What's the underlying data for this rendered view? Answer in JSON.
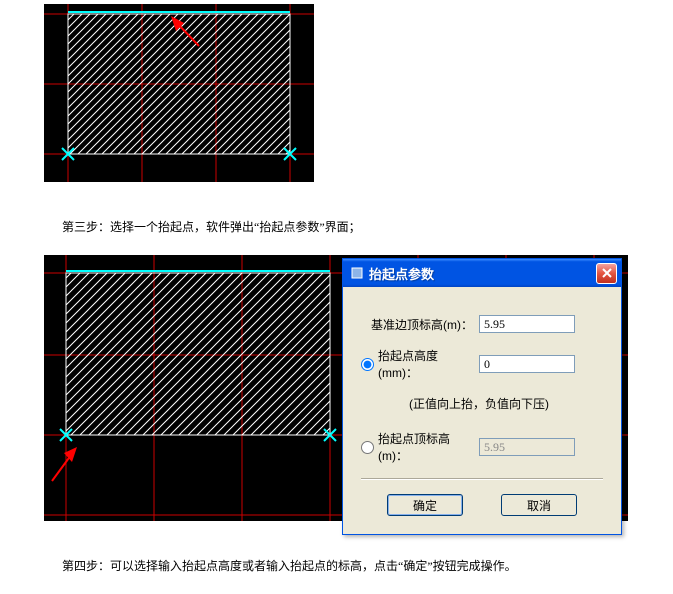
{
  "step3": "第三步：选择一个抬起点，软件弹出“抬起点参数”界面；",
  "step4": "第四步：可以选择输入抬起点高度或者输入抬起点的标高，点击“确定”按钮完成操作。",
  "dialog": {
    "title": "抬起点参数",
    "base_elevation_label": "基准边顶标高(m)：",
    "base_elevation_value": "5.95",
    "lift_height_label": "抬起点高度(mm)：",
    "lift_height_value": "0",
    "note": "(正值向上抬，负值向下压)",
    "lift_elevation_label": "抬起点顶标高(m)：",
    "lift_elevation_value": "5.95",
    "ok": "确定",
    "cancel": "取消"
  }
}
